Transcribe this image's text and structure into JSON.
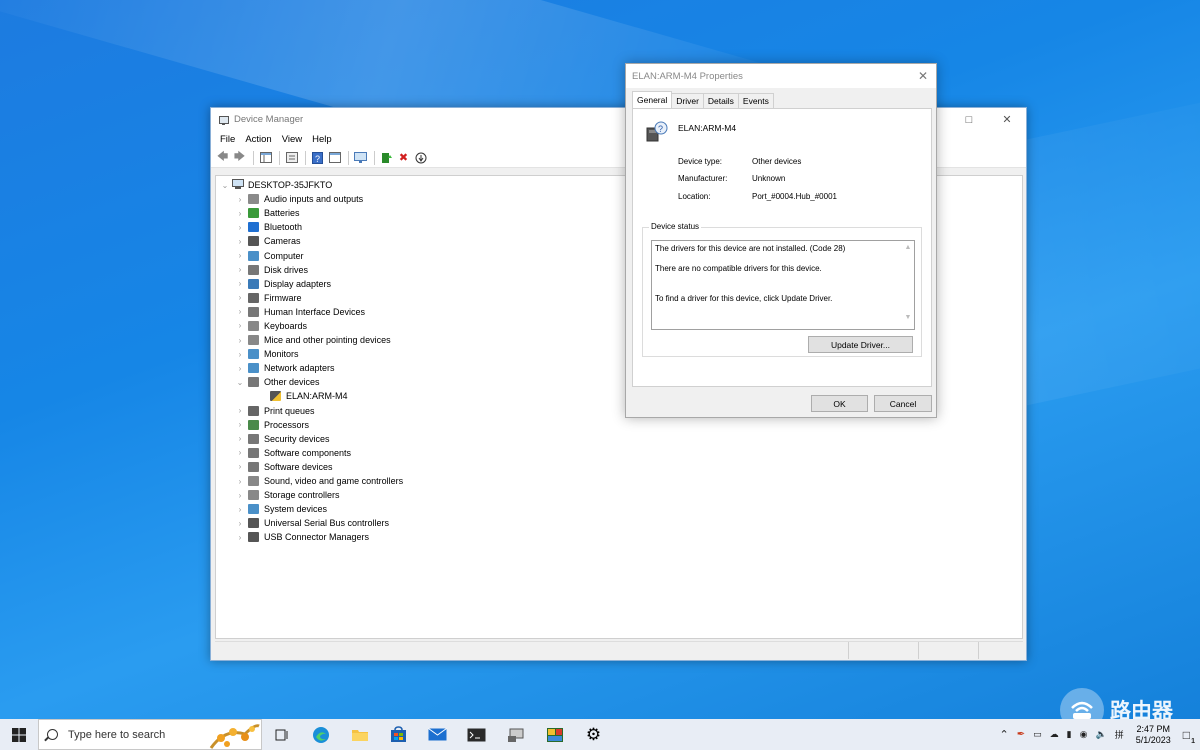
{
  "device_manager": {
    "title": "Device Manager",
    "menu": [
      "File",
      "Action",
      "View",
      "Help"
    ],
    "root": "DESKTOP-35JFKTO",
    "categories": [
      {
        "label": "Audio inputs and outputs",
        "icon": "speaker-icon",
        "color": "#8a8a8a"
      },
      {
        "label": "Batteries",
        "icon": "battery-icon",
        "color": "#3a9a3a"
      },
      {
        "label": "Bluetooth",
        "icon": "bluetooth-icon",
        "color": "#1f6fd1"
      },
      {
        "label": "Cameras",
        "icon": "camera-icon",
        "color": "#555555"
      },
      {
        "label": "Computer",
        "icon": "computer-icon",
        "color": "#4a90c8"
      },
      {
        "label": "Disk drives",
        "icon": "disk-icon",
        "color": "#777777"
      },
      {
        "label": "Display adapters",
        "icon": "display-adapter-icon",
        "color": "#3a7ab8"
      },
      {
        "label": "Firmware",
        "icon": "firmware-icon",
        "color": "#666666"
      },
      {
        "label": "Human Interface Devices",
        "icon": "hid-icon",
        "color": "#777777"
      },
      {
        "label": "Keyboards",
        "icon": "keyboard-icon",
        "color": "#888888"
      },
      {
        "label": "Mice and other pointing devices",
        "icon": "mouse-icon",
        "color": "#888888"
      },
      {
        "label": "Monitors",
        "icon": "monitor-icon",
        "color": "#4a90c8"
      },
      {
        "label": "Network adapters",
        "icon": "network-icon",
        "color": "#4a90c8"
      },
      {
        "label": "Other devices",
        "icon": "unknown-device-icon",
        "color": "#777777"
      },
      {
        "label": "ELAN:ARM-M4",
        "icon": "warning-device-icon",
        "color": "#c88a20",
        "child": true
      },
      {
        "label": "Print queues",
        "icon": "printer-icon",
        "color": "#666666"
      },
      {
        "label": "Processors",
        "icon": "processor-icon",
        "color": "#4a8a4a"
      },
      {
        "label": "Security devices",
        "icon": "security-icon",
        "color": "#777777"
      },
      {
        "label": "Software components",
        "icon": "software-component-icon",
        "color": "#777777"
      },
      {
        "label": "Software devices",
        "icon": "software-device-icon",
        "color": "#777777"
      },
      {
        "label": "Sound, video and game controllers",
        "icon": "sound-icon",
        "color": "#888888"
      },
      {
        "label": "Storage controllers",
        "icon": "storage-icon",
        "color": "#888888"
      },
      {
        "label": "System devices",
        "icon": "system-device-icon",
        "color": "#4a90c8"
      },
      {
        "label": "Universal Serial Bus controllers",
        "icon": "usb-icon",
        "color": "#555555"
      },
      {
        "label": "USB Connector Managers",
        "icon": "usb-connector-icon",
        "color": "#555555"
      }
    ]
  },
  "properties": {
    "title": "ELAN:ARM-M4 Properties",
    "tabs": [
      "General",
      "Driver",
      "Details",
      "Events"
    ],
    "device_name": "ELAN:ARM-M4",
    "device_type_label": "Device type:",
    "device_type": "Other devices",
    "manufacturer_label": "Manufacturer:",
    "manufacturer": "Unknown",
    "location_label": "Location:",
    "location": "Port_#0004.Hub_#0001",
    "status_legend": "Device status",
    "status_line1": "The drivers for this device are not installed. (Code 28)",
    "status_line2": "There are no compatible drivers for this device.",
    "status_line3": "To find a driver for this device, click Update Driver.",
    "update_button": "Update Driver...",
    "ok_button": "OK",
    "cancel_button": "Cancel"
  },
  "taskbar": {
    "search_placeholder": "Type here to search",
    "time": "2:47 PM",
    "date": "5/1/2023",
    "notification_count": "1"
  },
  "watermark": "路由器"
}
